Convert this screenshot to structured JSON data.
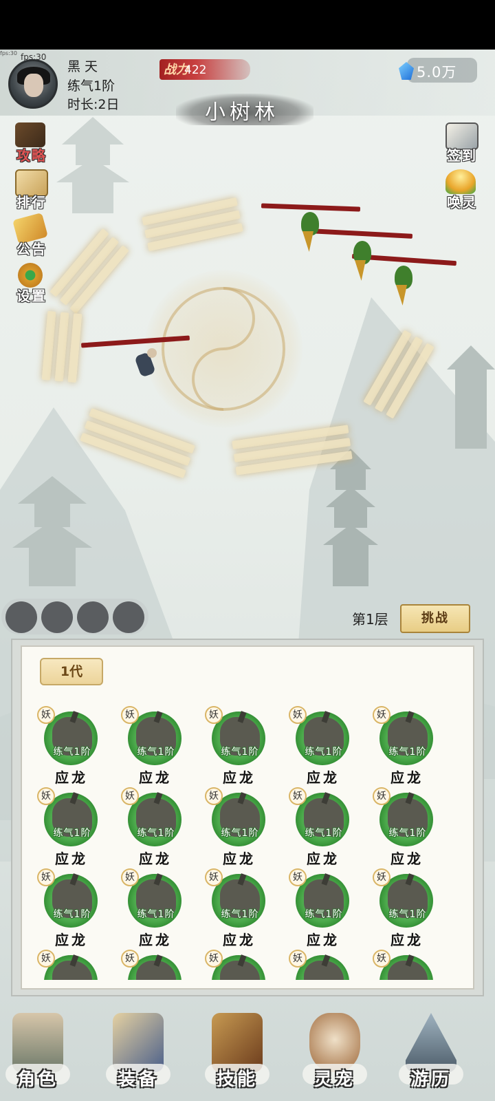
{
  "debug": {
    "fps": "fps:30",
    "fps_small": "fps:30"
  },
  "player": {
    "name": "黑天",
    "realm": "练气1阶",
    "duration": "时长:2日"
  },
  "power": {
    "label": "战力",
    "value": "422"
  },
  "currency": {
    "gems": "5.0万",
    "icon": "gem-icon"
  },
  "location": "小树林",
  "left_menu": [
    {
      "key": "guide",
      "label": "攻略",
      "icon": "scroll-icon"
    },
    {
      "key": "ranking",
      "label": "排行",
      "icon": "ranking-scroll-icon"
    },
    {
      "key": "notice",
      "label": "公告",
      "icon": "notice-scroll-icon"
    },
    {
      "key": "settings",
      "label": "设置",
      "icon": "gear-icon"
    }
  ],
  "right_menu": [
    {
      "key": "checkin",
      "label": "签到",
      "icon": "brush-scroll-icon"
    },
    {
      "key": "summon",
      "label": "唤灵",
      "icon": "summon-cauldron-icon"
    }
  ],
  "battle": {
    "floor": "第1层",
    "challenge_label": "挑战",
    "skill_slots": 4
  },
  "panel": {
    "generation_tab": "1代",
    "pets": [
      {
        "tag": "妖",
        "rank": "练气1阶",
        "name": "应龙"
      },
      {
        "tag": "妖",
        "rank": "练气1阶",
        "name": "应龙"
      },
      {
        "tag": "妖",
        "rank": "练气1阶",
        "name": "应龙"
      },
      {
        "tag": "妖",
        "rank": "练气1阶",
        "name": "应龙"
      },
      {
        "tag": "妖",
        "rank": "练气1阶",
        "name": "应龙"
      },
      {
        "tag": "妖",
        "rank": "练气1阶",
        "name": "应龙"
      },
      {
        "tag": "妖",
        "rank": "练气1阶",
        "name": "应龙"
      },
      {
        "tag": "妖",
        "rank": "练气1阶",
        "name": "应龙"
      },
      {
        "tag": "妖",
        "rank": "练气1阶",
        "name": "应龙"
      },
      {
        "tag": "妖",
        "rank": "练气1阶",
        "name": "应龙"
      },
      {
        "tag": "妖",
        "rank": "练气1阶",
        "name": "应龙"
      },
      {
        "tag": "妖",
        "rank": "练气1阶",
        "name": "应龙"
      },
      {
        "tag": "妖",
        "rank": "练气1阶",
        "name": "应龙"
      },
      {
        "tag": "妖",
        "rank": "练气1阶",
        "name": "应龙"
      },
      {
        "tag": "妖",
        "rank": "练气1阶",
        "name": "应龙"
      },
      {
        "tag": "妖",
        "rank": "",
        "name": ""
      },
      {
        "tag": "妖",
        "rank": "",
        "name": ""
      },
      {
        "tag": "妖",
        "rank": "",
        "name": ""
      },
      {
        "tag": "妖",
        "rank": "",
        "name": ""
      },
      {
        "tag": "妖",
        "rank": "",
        "name": ""
      }
    ]
  },
  "bottom_nav": [
    {
      "key": "character",
      "label": "角色",
      "icon": "cultivator-icon"
    },
    {
      "key": "equipment",
      "label": "装备",
      "icon": "gourd-bundle-icon"
    },
    {
      "key": "skills",
      "label": "技能",
      "icon": "skill-scroll-icon"
    },
    {
      "key": "pets",
      "label": "灵宠",
      "icon": "fox-icon"
    },
    {
      "key": "travel",
      "label": "游历",
      "icon": "mountain-icon"
    }
  ],
  "colors": {
    "hp_bar": "#8c1a1a",
    "pet_ring": "#4aa84a",
    "challenge_btn": "#ecd49a"
  }
}
